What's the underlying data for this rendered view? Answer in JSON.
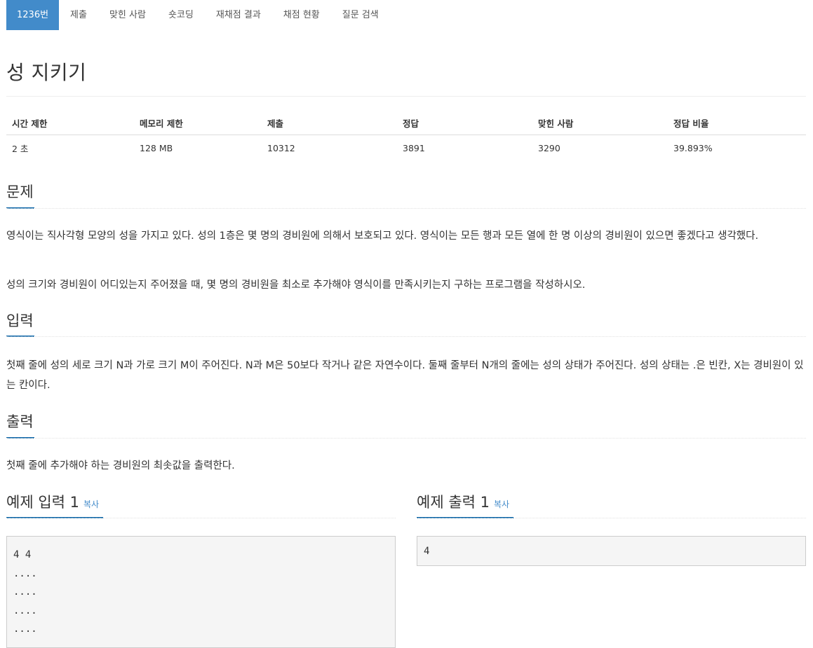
{
  "tabs": [
    {
      "label": "1236번",
      "active": true
    },
    {
      "label": "제출"
    },
    {
      "label": "맞힌 사람"
    },
    {
      "label": "숏코딩"
    },
    {
      "label": "재채점 결과"
    },
    {
      "label": "채점 현황"
    },
    {
      "label": "질문 검색"
    }
  ],
  "problem": {
    "title": "성 지키기",
    "info_headers": [
      "시간 제한",
      "메모리 제한",
      "제출",
      "정답",
      "맞힌 사람",
      "정답 비율"
    ],
    "info_values": [
      "2 초",
      "128 MB",
      "10312",
      "3891",
      "3290",
      "39.893%"
    ]
  },
  "sections": {
    "problem": {
      "title": "문제",
      "paragraphs": [
        "영식이는 직사각형 모양의 성을 가지고 있다. 성의 1층은 몇 명의 경비원에 의해서 보호되고 있다. 영식이는 모든 행과 모든 열에 한 명 이상의 경비원이 있으면 좋겠다고 생각했다.",
        "성의 크기와 경비원이 어디있는지 주어졌을 때, 몇 명의 경비원을 최소로 추가해야 영식이를 만족시키는지 구하는 프로그램을 작성하시오."
      ]
    },
    "input": {
      "title": "입력",
      "paragraph": "첫째 줄에 성의 세로 크기 N과 가로 크기 M이 주어진다. N과 M은 50보다 작거나 같은 자연수이다. 둘째 줄부터 N개의 줄에는 성의 상태가 주어진다. 성의 상태는 .은 빈칸, X는 경비원이 있는 칸이다."
    },
    "output": {
      "title": "출력",
      "paragraph": "첫째 줄에 추가해야 하는 경비원의 최솟값을 출력한다."
    }
  },
  "samples": {
    "input": {
      "title": "예제 입력 1",
      "copy": "복사",
      "content": "4 4\n....\n....\n....\n...."
    },
    "output": {
      "title": "예제 출력 1",
      "copy": "복사",
      "content": "4"
    }
  },
  "colors": {
    "accent": "#428bca",
    "underline": "#0b65a8"
  }
}
